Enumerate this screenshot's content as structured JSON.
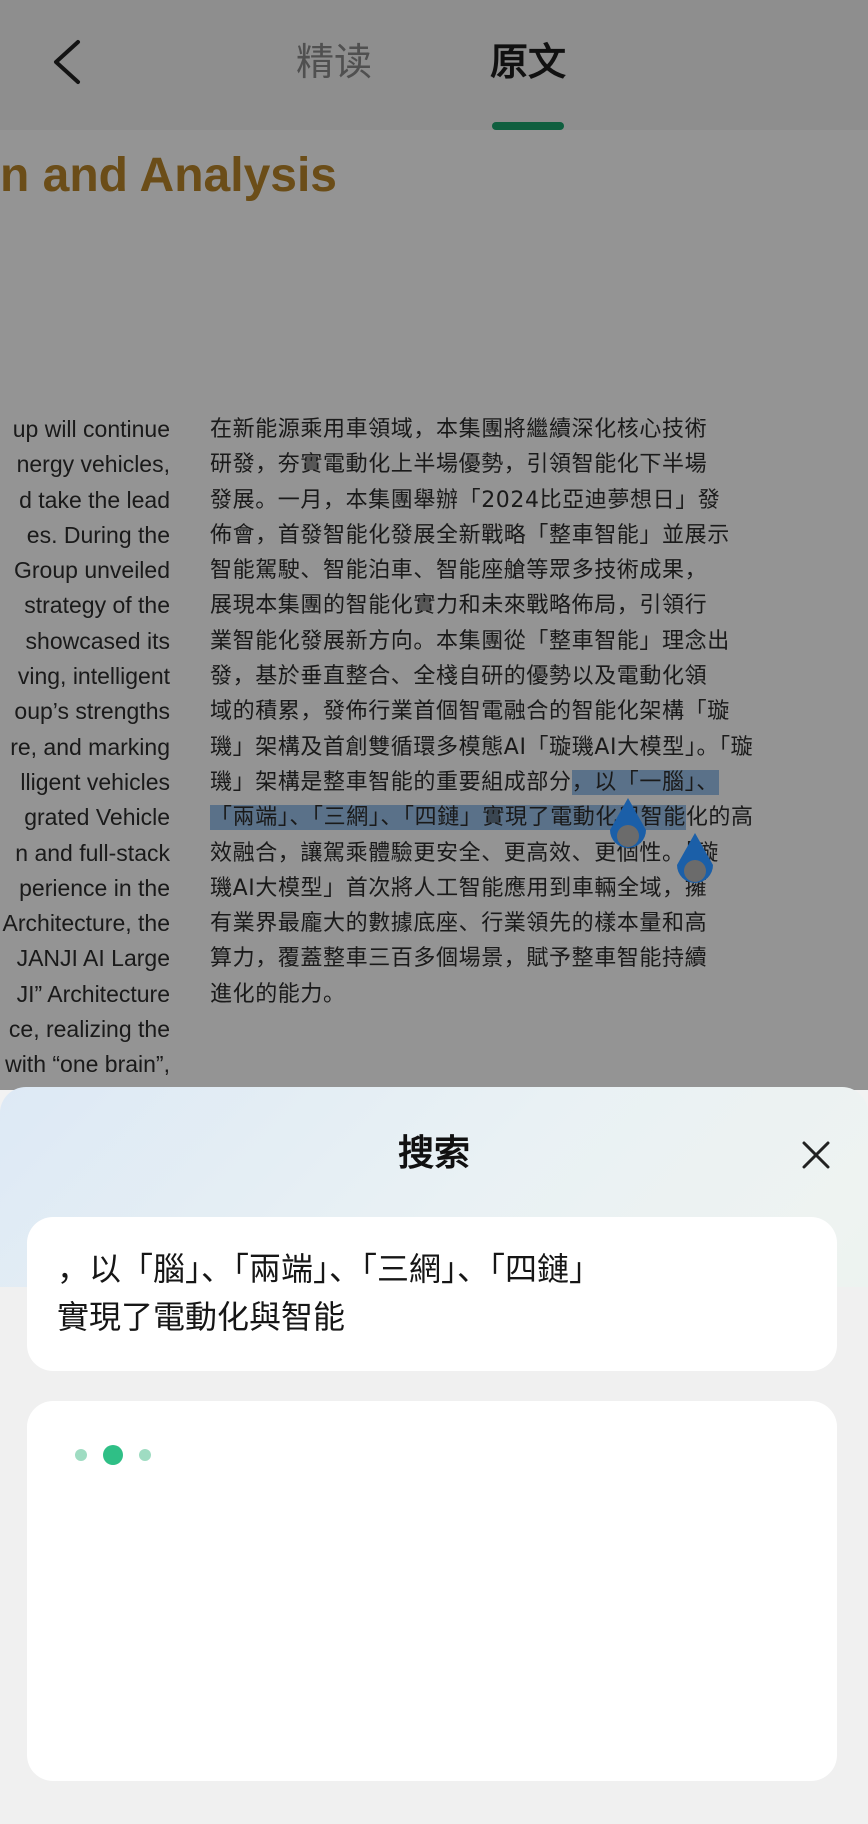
{
  "header": {
    "tabs": [
      {
        "label": "精读",
        "active": false
      },
      {
        "label": "原文",
        "active": true
      }
    ],
    "accent_color": "#1aa46d"
  },
  "document": {
    "title": "n and Analysis",
    "title_color": "#b8862a",
    "english_lines": [
      "up will continue",
      "nergy vehicles,",
      "d take the lead",
      "es. During the",
      "Group unveiled",
      "strategy of the",
      "showcased its",
      "ving, intelligent",
      "oup’s strengths",
      "re, and marking",
      "lligent vehicles",
      "grated Vehicle",
      "n and full-stack",
      "perience in the",
      "Architecture, the",
      "JANJI AI Large",
      "JI” Architecture",
      "ce, realizing the",
      "with “one brain”,"
    ],
    "chinese_lines": [
      "在新能源乘用車領域，本集團將繼續深化核心技術",
      "研發，夯實電動化上半場優勢，引領智能化下半場",
      "發展。一月，本集團舉辦「2024比亞迪夢想日」發",
      "佈會，首發智能化發展全新戰略「整車智能」並展示",
      "智能駕駛、智能泊車、智能座艙等眾多技術成果，",
      "展現本集團的智能化實力和未來戰略佈局，引領行",
      "業智能化發展新方向。本集團從「整車智能」理念出",
      "發，基於垂直整合、全棧自研的優勢以及電動化領",
      "域的積累，發佈行業首個智電融合的智能化架構「璇",
      "璣」架構及首創雙循環多模態AI「璇璣AI大模型」。「璇",
      "璣」架構是整車智能的重要組成部分",
      "，以「一腦」、",
      "「兩端」、「三網」、「四鏈」實現了電動化與智能",
      "化的高",
      "效融合，讓駕乘體驗更安全、更高效、更個性。「璇",
      "璣AI大模型」首次將人工智能應用到車輛全域，擁",
      "有業界最龐大的數據底座、行業領先的樣本量和高",
      "算力，覆蓋整車三百多個場景，賦予整車智能持續",
      "進化的能力。"
    ],
    "highlight_color": "#9cc3ec"
  },
  "search_sheet": {
    "title": "搜索",
    "query": "，以「腦」、「兩端」、「三網」、「四鏈」\n實現了電動化與智能",
    "loading_color": "#2fbf86"
  }
}
